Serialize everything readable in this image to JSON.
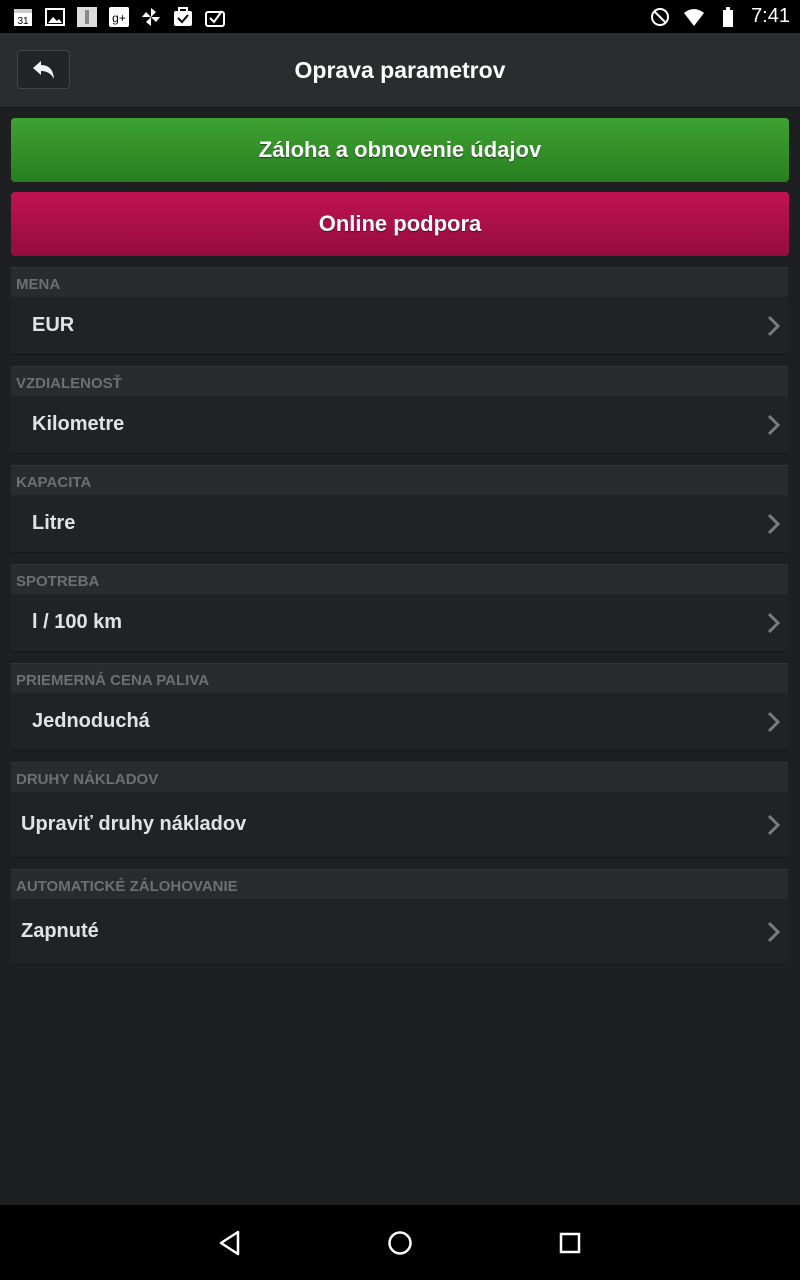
{
  "status_bar": {
    "time": "7:41",
    "icons_left": [
      "calendar-icon",
      "gallery-icon",
      "app-icon",
      "google-plus-icon",
      "pinwheel-icon",
      "task-icon",
      "task-alt-icon"
    ],
    "icons_right": [
      "do-not-disturb-icon",
      "wifi-icon",
      "battery-icon"
    ]
  },
  "header": {
    "title": "Oprava parametrov",
    "back_icon": "undo-arrow-icon"
  },
  "buttons": {
    "backup_label": "Záloha a obnovenie údajov",
    "support_label": "Online podpora",
    "backup_color": "#2f8f26",
    "support_color": "#b0104a"
  },
  "sections": [
    {
      "header": "MENA",
      "value": "EUR"
    },
    {
      "header": "VZDIALENOSŤ",
      "value": "Kilometre"
    },
    {
      "header": "KAPACITA",
      "value": "Litre"
    },
    {
      "header": "SPOTREBA",
      "value": "l / 100 km"
    },
    {
      "header": "PRIEMERNÁ CENA PALIVA",
      "value": "Jednoduchá"
    },
    {
      "header": "DRUHY NÁKLADOV",
      "value": "Upraviť druhy nákladov"
    },
    {
      "header": "AUTOMATICKÉ ZÁLOHOVANIE",
      "value": "Zapnuté"
    }
  ],
  "nav_bar": {
    "icons": [
      "back-triangle-icon",
      "home-circle-icon",
      "recents-square-icon"
    ]
  }
}
